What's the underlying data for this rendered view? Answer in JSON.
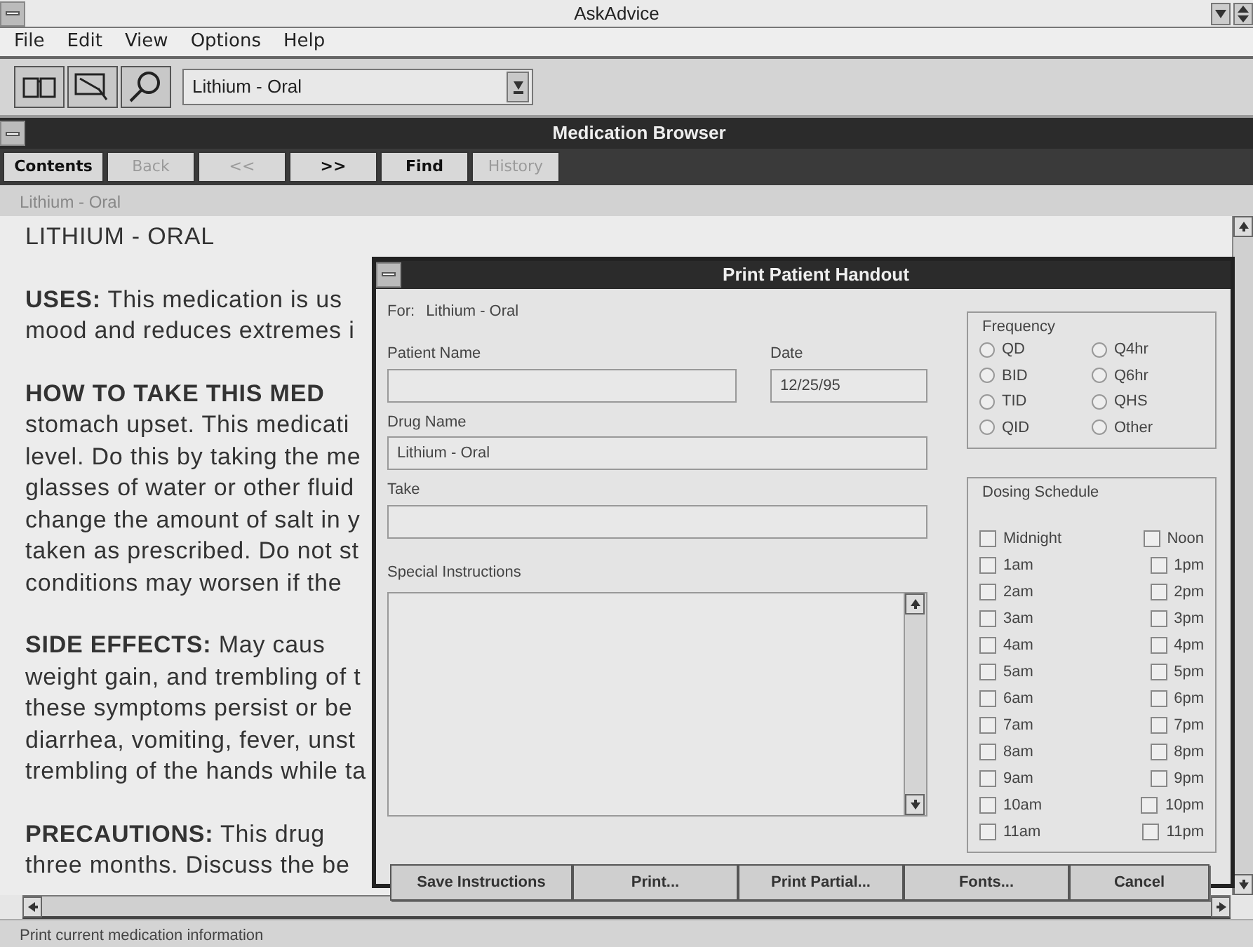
{
  "window": {
    "title": "AskAdvice"
  },
  "menu": [
    {
      "label": "File"
    },
    {
      "label": "Edit"
    },
    {
      "label": "View"
    },
    {
      "label": "Options"
    },
    {
      "label": "Help"
    }
  ],
  "toolbar": {
    "combo_value": "Lithium - Oral"
  },
  "browser": {
    "title": "Medication Browser",
    "buttons": [
      {
        "label": "Contents",
        "disabled": false
      },
      {
        "label": "Back",
        "disabled": true
      },
      {
        "label": "<<",
        "disabled": true
      },
      {
        "label": ">>",
        "disabled": false
      },
      {
        "label": "Find",
        "disabled": false
      },
      {
        "label": "History",
        "disabled": true
      }
    ],
    "breadcrumb": "Lithium - Oral",
    "heading": "LITHIUM - ORAL",
    "paragraphs": [
      [
        "**USES:**  This medication is us",
        "mood and reduces extremes i"
      ],
      [
        "**HOW TO TAKE THIS MED**",
        "stomach upset. This medicati",
        "level. Do this by taking the me",
        "glasses of water or other fluid",
        "change the amount of salt in y",
        "taken as prescribed. Do not st",
        "conditions may worsen if the"
      ],
      [
        "**SIDE EFFECTS:**  May caus",
        "weight gain, and trembling of t",
        "these symptoms persist or be",
        "diarrhea, vomiting, fever, unst",
        "trembling of the hands while ta"
      ],
      [
        "**PRECAUTIONS:**  This drug",
        "three months. Discuss the be"
      ]
    ]
  },
  "dialog": {
    "title": "Print Patient Handout",
    "for_label": "For:",
    "for_value": "Lithium - Oral",
    "patient_name": {
      "label": "Patient Name"
    },
    "date": {
      "label": "Date",
      "value": "12/25/95"
    },
    "drug_name": {
      "label": "Drug Name",
      "value": "Lithium - Oral"
    },
    "take": {
      "label": "Take"
    },
    "special_instructions": {
      "label": "Special Instructions"
    },
    "frequency": {
      "title": "Frequency",
      "options": [
        {
          "label": "QD",
          "selected": false
        },
        {
          "label": "Q4hr",
          "selected": false
        },
        {
          "label": "BID",
          "selected": false
        },
        {
          "label": "Q6hr",
          "selected": false
        },
        {
          "label": "TID",
          "selected": false
        },
        {
          "label": "QHS",
          "selected": false
        },
        {
          "label": "QID",
          "selected": false
        },
        {
          "label": "Other",
          "selected": false
        }
      ]
    },
    "dosing_schedule": {
      "title": "Dosing Schedule",
      "slots": [
        {
          "label": "Midnight",
          "checked": false
        },
        {
          "label": "Noon",
          "checked": false
        },
        {
          "label": "1am",
          "checked": false
        },
        {
          "label": "1pm",
          "checked": false
        },
        {
          "label": "2am",
          "checked": false
        },
        {
          "label": "2pm",
          "checked": false
        },
        {
          "label": "3am",
          "checked": false
        },
        {
          "label": "3pm",
          "checked": false
        },
        {
          "label": "4am",
          "checked": false
        },
        {
          "label": "4pm",
          "checked": false
        },
        {
          "label": "5am",
          "checked": false
        },
        {
          "label": "5pm",
          "checked": false
        },
        {
          "label": "6am",
          "checked": false
        },
        {
          "label": "6pm",
          "checked": false
        },
        {
          "label": "7am",
          "checked": false
        },
        {
          "label": "7pm",
          "checked": false
        },
        {
          "label": "8am",
          "checked": false
        },
        {
          "label": "8pm",
          "checked": false
        },
        {
          "label": "9am",
          "checked": false
        },
        {
          "label": "9pm",
          "checked": false
        },
        {
          "label": "10am",
          "checked": false
        },
        {
          "label": "10pm",
          "checked": false
        },
        {
          "label": "11am",
          "checked": false
        },
        {
          "label": "11pm",
          "checked": false
        }
      ]
    },
    "buttons": [
      "Save Instructions",
      "Print...",
      "Print Partial...",
      "Fonts...",
      "Cancel"
    ]
  },
  "status_bar": "Print current medication information"
}
